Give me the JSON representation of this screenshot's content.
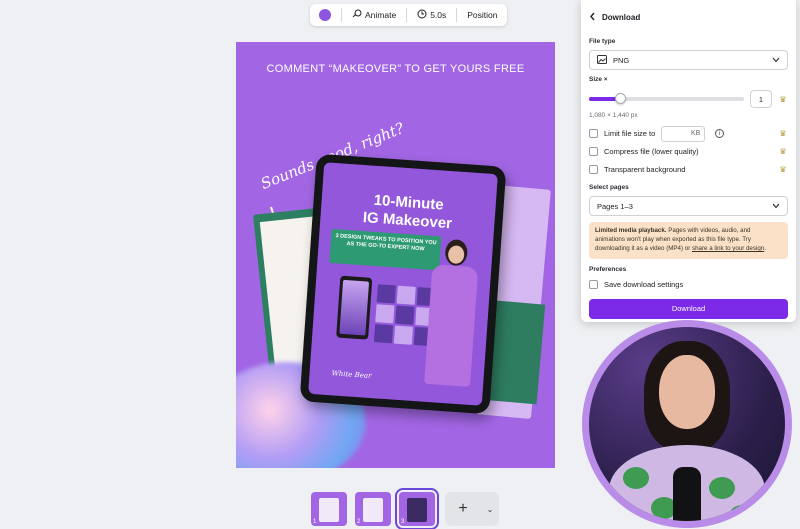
{
  "toolbar": {
    "color_swatch": "#8d55e0",
    "animate_label": "Animate",
    "duration_label": "5.0s",
    "position_label": "Position"
  },
  "canvas": {
    "header_text": "COMMENT “MAKEOVER” TO GET YOURS FREE",
    "script_text": "Sounds good, right?",
    "tablet_title_line1": "10-Minute",
    "tablet_title_line2": "IG Makeover",
    "tablet_banner": "3 DESIGN TWEAKS TO POSITION YOU AS THE GO-TO EXPERT NOW",
    "tablet_signature": "White Bear",
    "background_color": "#a266e4"
  },
  "pages": {
    "thumbnails": [
      {
        "label": "1",
        "active": false
      },
      {
        "label": "2",
        "active": false
      },
      {
        "label": "3",
        "active": true
      }
    ],
    "add_label": "+",
    "more_label": "⌄"
  },
  "download_panel": {
    "title": "Download",
    "file_type_label": "File type",
    "file_type_value": "PNG",
    "size_label": "Size ×",
    "size_value": "1",
    "size_fraction": 0.2,
    "dimensions": "1,080 × 1,440 px",
    "limit_file_size_label": "Limit file size to",
    "kb_unit": "KB",
    "compress_label": "Compress file (lower quality)",
    "transparent_label": "Transparent background",
    "select_pages_label": "Select pages",
    "pages_value": "Pages 1–3",
    "notice_bold": "Limited media playback.",
    "notice_text": " Pages with videos, audio, and animations won't play when exported as this file type. Try downloading it as a video (MP4) or ",
    "notice_link": "share a link to your design",
    "notice_end": ".",
    "preferences_label": "Preferences",
    "save_settings_label": "Save download settings",
    "download_button": "Download",
    "accent_color": "#7d2ae8"
  }
}
